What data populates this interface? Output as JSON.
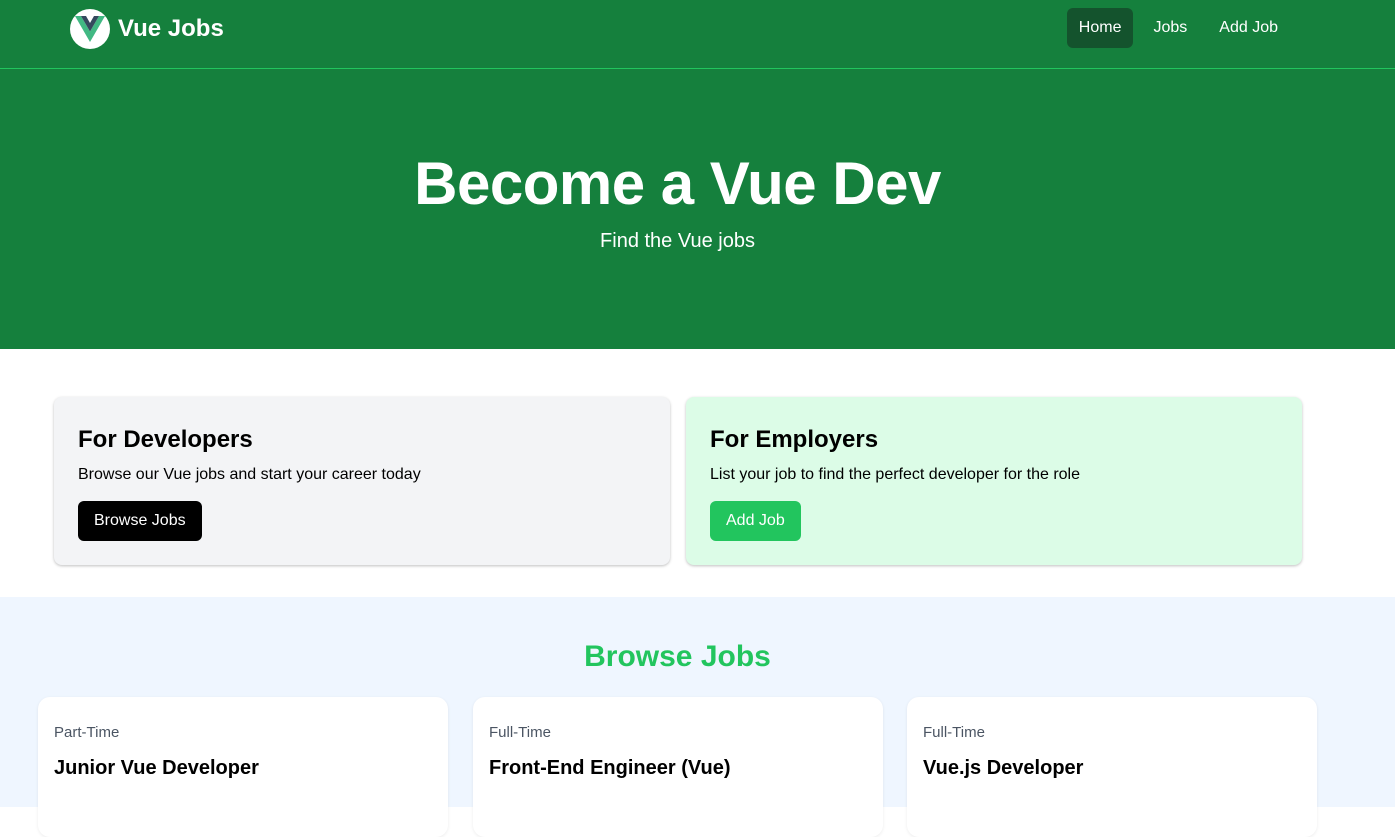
{
  "nav": {
    "brand": "Vue Jobs",
    "links": [
      {
        "label": "Home",
        "active": true
      },
      {
        "label": "Jobs",
        "active": false
      },
      {
        "label": "Add Job",
        "active": false
      }
    ]
  },
  "hero": {
    "title": "Become a Vue Dev",
    "subtitle": "Find the Vue jobs"
  },
  "cards": {
    "developers": {
      "title": "For Developers",
      "text": "Browse our Vue jobs and start your career today",
      "button": "Browse Jobs"
    },
    "employers": {
      "title": "For Employers",
      "text": "List your job to find the perfect developer for the role",
      "button": "Add Job"
    }
  },
  "browse": {
    "heading": "Browse Jobs",
    "jobs": [
      {
        "type": "Part-Time",
        "title": "Junior Vue Developer"
      },
      {
        "type": "Full-Time",
        "title": "Front-End Engineer (Vue)"
      },
      {
        "type": "Full-Time",
        "title": "Vue.js Developer"
      }
    ]
  },
  "colors": {
    "primary": "#15803d",
    "accent": "#22c55e",
    "active_nav": "#14532d"
  }
}
